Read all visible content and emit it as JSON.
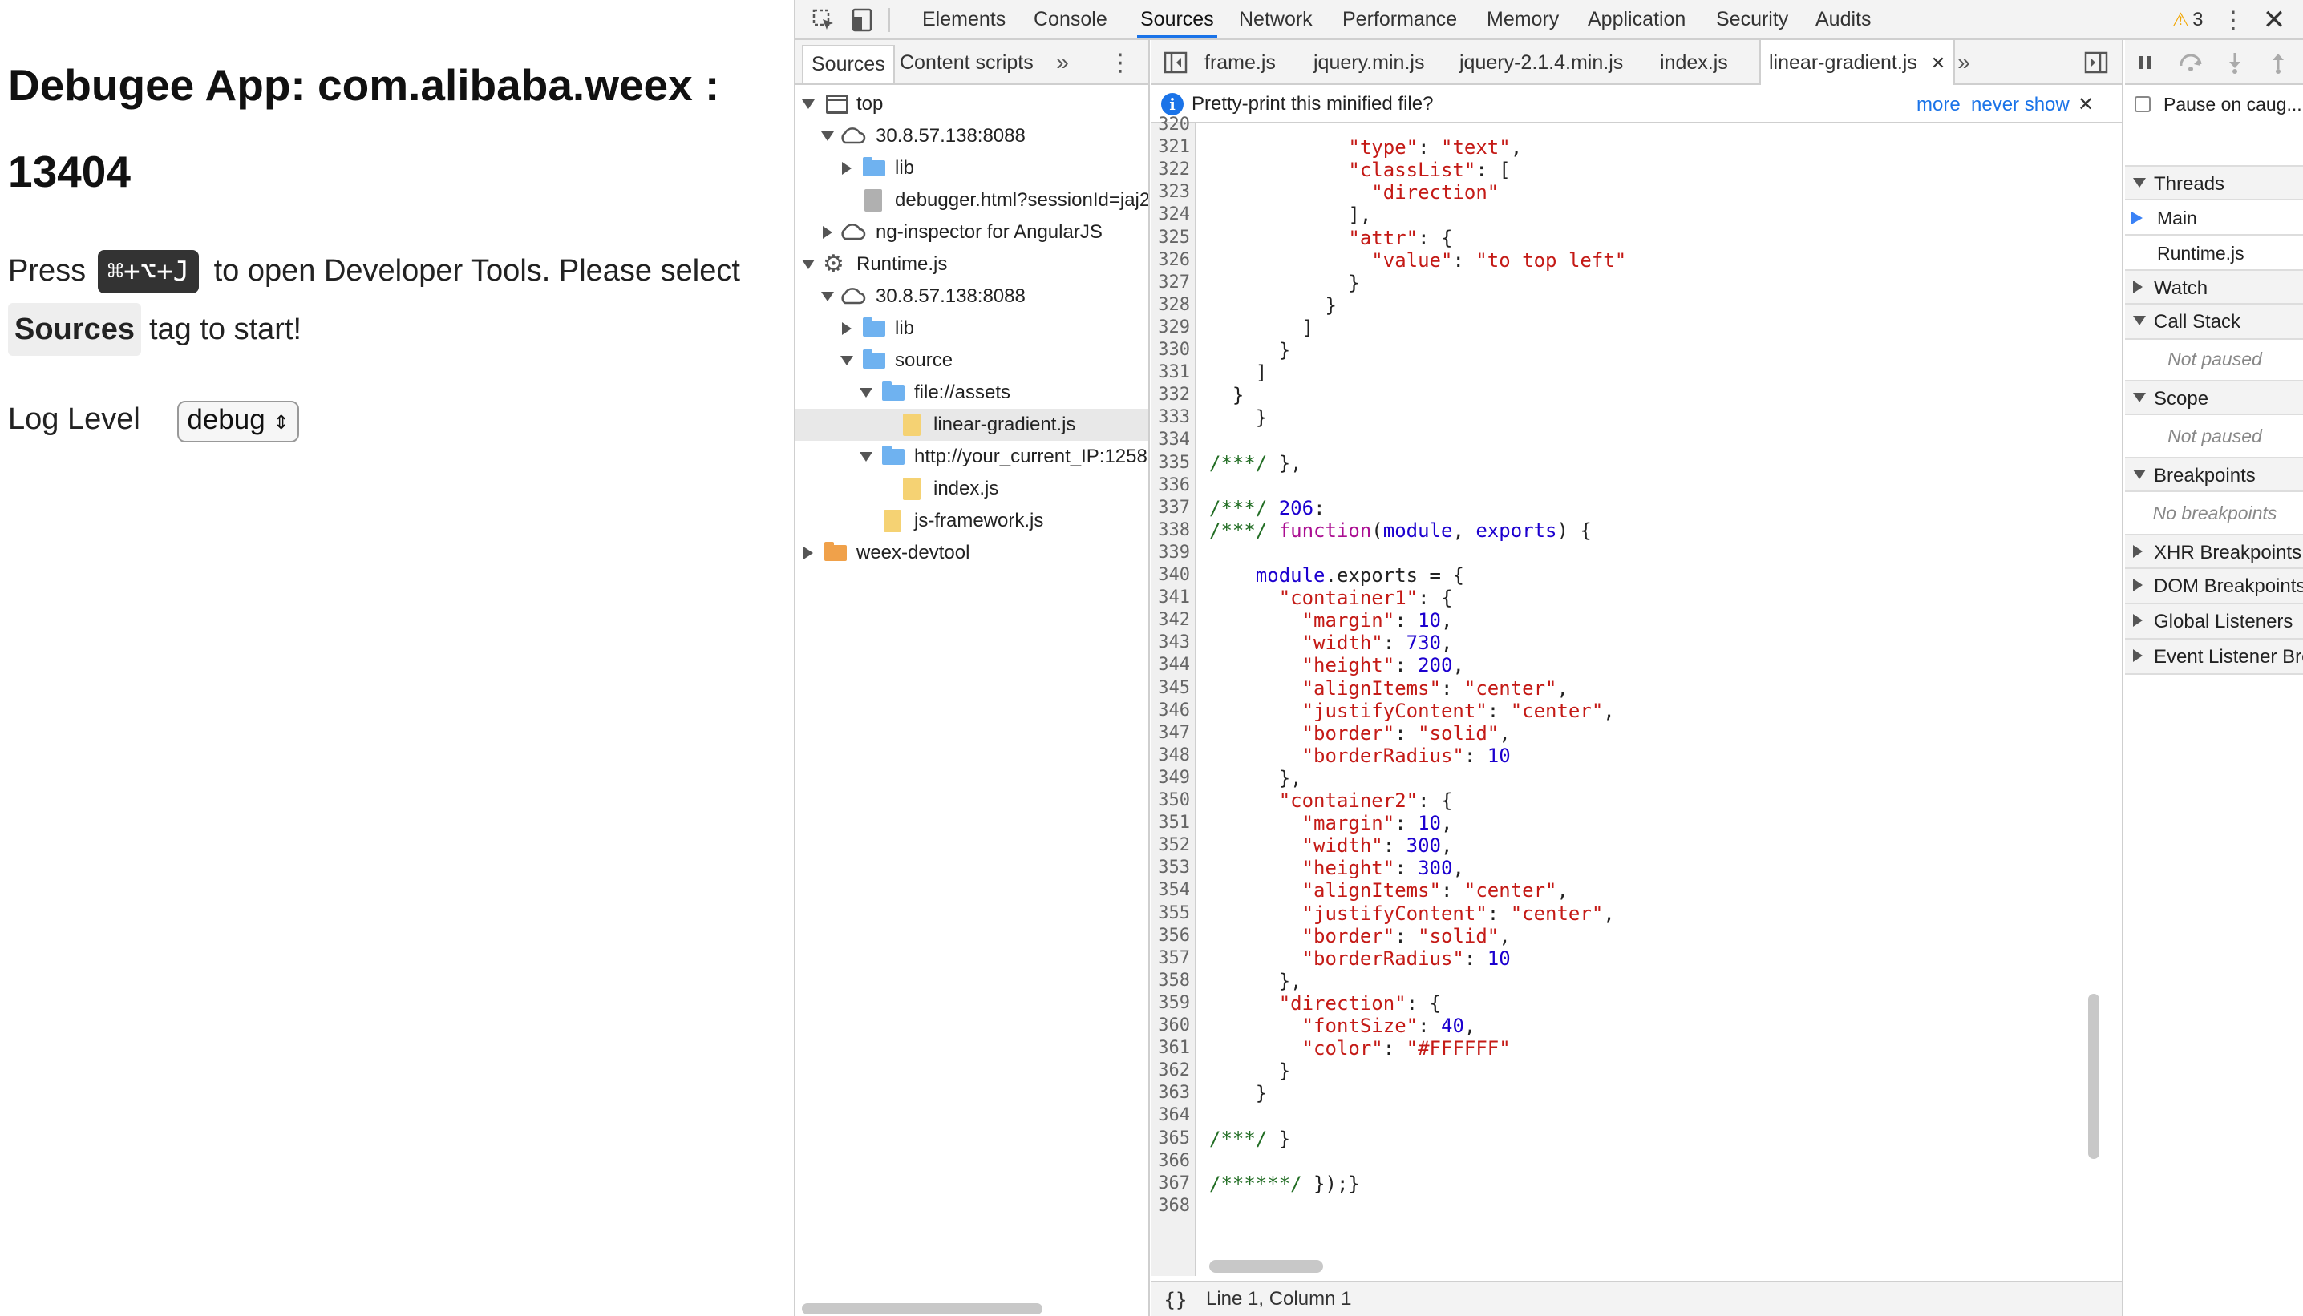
{
  "app": {
    "title": "Debugee App: com.alibaba.weex : 13404",
    "press": "Press",
    "shortcut": "⌘+⌥+J",
    "to_open": "to open Developer Tools. Please select",
    "sources_tag": "Sources",
    "tag_to_start": "tag to start!",
    "log_level_label": "Log Level",
    "log_level_value": "debug"
  },
  "devtools": {
    "main_tabs": [
      "Elements",
      "Console",
      "Sources",
      "Network",
      "Performance",
      "Memory",
      "Application",
      "Security",
      "Audits"
    ],
    "active_main_tab": "Sources",
    "warning_count": "3",
    "navigator": {
      "tabs": [
        "Sources",
        "Content scripts"
      ],
      "tree": [
        {
          "label": "top"
        },
        {
          "label": "30.8.57.138:8088"
        },
        {
          "label": "lib"
        },
        {
          "label": "debugger.html?sessionId=jaj2"
        },
        {
          "label": "ng-inspector for AngularJS"
        },
        {
          "label": "Runtime.js"
        },
        {
          "label": "30.8.57.138:8088"
        },
        {
          "label": "lib"
        },
        {
          "label": "source"
        },
        {
          "label": "file://assets"
        },
        {
          "label": "linear-gradient.js"
        },
        {
          "label": "http://your_current_IP:1258"
        },
        {
          "label": "index.js"
        },
        {
          "label": "js-framework.js"
        },
        {
          "label": "weex-devtool"
        }
      ]
    },
    "editor": {
      "tabs": [
        "frame.js",
        "jquery.min.js",
        "jquery-2.1.4.min.js",
        "index.js",
        "linear-gradient.js"
      ],
      "active_tab": "linear-gradient.js",
      "infobar": {
        "text": "Pretty-print this minified file?",
        "more": "more",
        "never_show": "never show"
      },
      "status": {
        "format_icon": "{}",
        "position": "Line 1, Column 1"
      },
      "first_line": 320
    },
    "sidebar": {
      "pause_on_caught": "Pause on caug...",
      "sections": {
        "threads": "Threads",
        "thread_main": "Main",
        "thread_runtime": "Runtime.js",
        "watch": "Watch",
        "call_stack": "Call Stack",
        "call_stack_empty": "Not paused",
        "scope": "Scope",
        "scope_empty": "Not paused",
        "breakpoints": "Breakpoints",
        "breakpoints_empty": "No breakpoints",
        "xhr": "XHR Breakpoints",
        "dom": "DOM Breakpoints",
        "global": "Global Listeners",
        "event": "Event Listener Brea"
      }
    }
  }
}
